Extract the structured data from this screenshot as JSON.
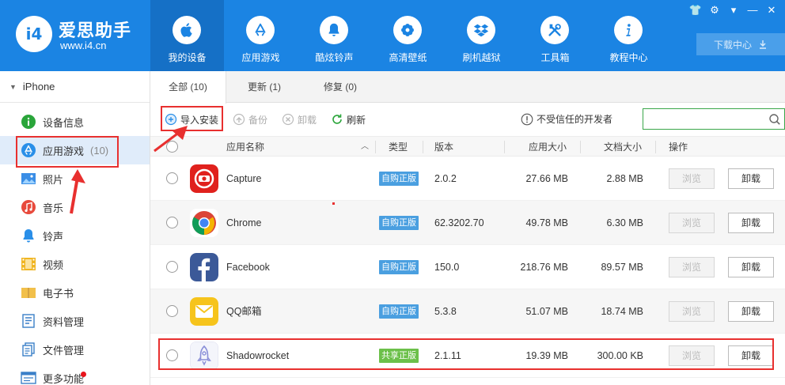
{
  "header": {
    "logo_name": "爱思助手",
    "logo_url": "www.i4.cn",
    "logo_badge": "i4",
    "nav": [
      {
        "label": "我的设备",
        "icon": "apple-icon"
      },
      {
        "label": "应用游戏",
        "icon": "app-store-icon"
      },
      {
        "label": "酷炫铃声",
        "icon": "bell-icon"
      },
      {
        "label": "高清壁纸",
        "icon": "flower-icon"
      },
      {
        "label": "刷机越狱",
        "icon": "dropbox-icon"
      },
      {
        "label": "工具箱",
        "icon": "tools-icon"
      },
      {
        "label": "教程中心",
        "icon": "info-icon"
      }
    ],
    "window_controls": [
      "👕",
      "⚙",
      "▾",
      "—",
      "✕"
    ],
    "download_label": "下载中心"
  },
  "sidebar": {
    "device": "iPhone",
    "items": [
      {
        "label": "设备信息",
        "icon": "info-circle-icon",
        "count": ""
      },
      {
        "label": "应用游戏",
        "icon": "app-store-icon",
        "count": "(10)"
      },
      {
        "label": "照片",
        "icon": "photo-icon",
        "count": ""
      },
      {
        "label": "音乐",
        "icon": "music-icon",
        "count": ""
      },
      {
        "label": "铃声",
        "icon": "bell-icon",
        "count": ""
      },
      {
        "label": "视频",
        "icon": "video-icon",
        "count": ""
      },
      {
        "label": "电子书",
        "icon": "book-icon",
        "count": ""
      },
      {
        "label": "资料管理",
        "icon": "contacts-icon",
        "count": ""
      },
      {
        "label": "文件管理",
        "icon": "files-icon",
        "count": ""
      },
      {
        "label": "更多功能",
        "icon": "more-icon",
        "count": ""
      }
    ]
  },
  "tabs": [
    {
      "label": "全部 (10)"
    },
    {
      "label": "更新 (1)"
    },
    {
      "label": "修复 (0)"
    }
  ],
  "toolbar": {
    "import_label": "导入安装",
    "backup_label": "备份",
    "uninstall_label": "卸载",
    "refresh_label": "刷新",
    "trust_label": "不受信任的开发者",
    "search_placeholder": ""
  },
  "table": {
    "headers": {
      "name": "应用名称",
      "type": "类型",
      "version": "版本",
      "app_size": "应用大小",
      "doc_size": "文档大小",
      "action": "操作"
    },
    "browse_label": "浏览",
    "uninstall_label": "卸载",
    "rows": [
      {
        "name": "Capture",
        "type": "自购正版",
        "version": "2.0.2",
        "app_size": "27.66 MB",
        "doc_size": "2.88 MB",
        "icon": "capture-icon"
      },
      {
        "name": "Chrome",
        "type": "自购正版",
        "version": "62.3202.70",
        "app_size": "49.78 MB",
        "doc_size": "6.30 MB",
        "icon": "chrome-icon"
      },
      {
        "name": "Facebook",
        "type": "自购正版",
        "version": "150.0",
        "app_size": "218.76 MB",
        "doc_size": "89.57 MB",
        "icon": "facebook-icon"
      },
      {
        "name": "QQ邮箱",
        "type": "自购正版",
        "version": "5.3.8",
        "app_size": "51.07 MB",
        "doc_size": "18.74 MB",
        "icon": "qqmail-icon"
      },
      {
        "name": "Shadowrocket",
        "type": "共享正版",
        "version": "2.1.11",
        "app_size": "19.39 MB",
        "doc_size": "300.00 KB",
        "icon": "shadowrocket-icon"
      }
    ]
  },
  "colors": {
    "brand": "#1b84e3",
    "highlight": "#e8302f",
    "badge_purchased": "#4a9fe0",
    "badge_shared": "#6cc04a"
  }
}
